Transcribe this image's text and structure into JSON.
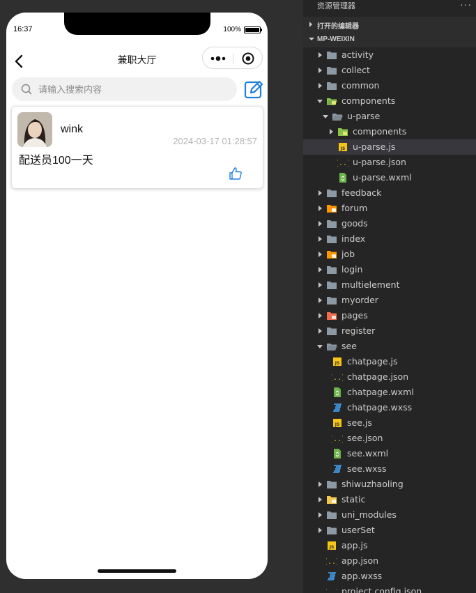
{
  "phone": {
    "status_time": "16:37",
    "battery_text": "100%",
    "nav_title": "兼职大厅",
    "search_placeholder": "请输入搜索内容",
    "post": {
      "author": "wink",
      "timestamp": "2024-03-17 01:28:57",
      "content": "配送员100一天"
    },
    "colors": {
      "accent": "#1e7fe0",
      "text": "#111111",
      "muted": "#b3b3b3"
    }
  },
  "explorer": {
    "title": "资源管理器",
    "more": "···",
    "sections": {
      "open_editors": "打开的编辑器",
      "project": "MP-WEIXIN"
    },
    "items": [
      {
        "label": "activity",
        "kind": "folder",
        "depth": 1,
        "expanded": false
      },
      {
        "label": "collect",
        "kind": "folder",
        "depth": 1,
        "expanded": false
      },
      {
        "label": "common",
        "kind": "folder",
        "depth": 1,
        "expanded": false
      },
      {
        "label": "components",
        "kind": "folder-green",
        "depth": 1,
        "expanded": true
      },
      {
        "label": "u-parse",
        "kind": "folder",
        "depth": 2,
        "expanded": true
      },
      {
        "label": "components",
        "kind": "folder-green",
        "depth": 3,
        "expanded": false
      },
      {
        "label": "u-parse.js",
        "kind": "js",
        "depth": 3,
        "selected": true
      },
      {
        "label": "u-parse.json",
        "kind": "json",
        "depth": 3
      },
      {
        "label": "u-parse.wxml",
        "kind": "wxml",
        "depth": 3
      },
      {
        "label": "feedback",
        "kind": "folder",
        "depth": 1,
        "expanded": false
      },
      {
        "label": "forum",
        "kind": "folder-orange",
        "depth": 1,
        "expanded": false
      },
      {
        "label": "goods",
        "kind": "folder",
        "depth": 1,
        "expanded": false
      },
      {
        "label": "index",
        "kind": "folder",
        "depth": 1,
        "expanded": false
      },
      {
        "label": "job",
        "kind": "folder-orange",
        "depth": 1,
        "expanded": false
      },
      {
        "label": "login",
        "kind": "folder",
        "depth": 1,
        "expanded": false
      },
      {
        "label": "multielement",
        "kind": "folder",
        "depth": 1,
        "expanded": false
      },
      {
        "label": "myorder",
        "kind": "folder",
        "depth": 1,
        "expanded": false
      },
      {
        "label": "pages",
        "kind": "folder-red",
        "depth": 1,
        "expanded": false
      },
      {
        "label": "register",
        "kind": "folder",
        "depth": 1,
        "expanded": false
      },
      {
        "label": "see",
        "kind": "folder",
        "depth": 1,
        "expanded": true
      },
      {
        "label": "chatpage.js",
        "kind": "js",
        "depth": 2
      },
      {
        "label": "chatpage.json",
        "kind": "json",
        "depth": 2
      },
      {
        "label": "chatpage.wxml",
        "kind": "wxml",
        "depth": 2
      },
      {
        "label": "chatpage.wxss",
        "kind": "wxss",
        "depth": 2
      },
      {
        "label": "see.js",
        "kind": "js",
        "depth": 2
      },
      {
        "label": "see.json",
        "kind": "json",
        "depth": 2
      },
      {
        "label": "see.wxml",
        "kind": "wxml",
        "depth": 2
      },
      {
        "label": "see.wxss",
        "kind": "wxss",
        "depth": 2
      },
      {
        "label": "shiwuzhaoling",
        "kind": "folder",
        "depth": 1,
        "expanded": false
      },
      {
        "label": "static",
        "kind": "folder-yellow",
        "depth": 1,
        "expanded": false
      },
      {
        "label": "uni_modules",
        "kind": "folder",
        "depth": 1,
        "expanded": false
      },
      {
        "label": "userSet",
        "kind": "folder",
        "depth": 1,
        "expanded": false
      },
      {
        "label": "app.js",
        "kind": "js",
        "depth": 1
      },
      {
        "label": "app.json",
        "kind": "json",
        "depth": 1
      },
      {
        "label": "app.wxss",
        "kind": "wxss",
        "depth": 1
      },
      {
        "label": "project.config.json",
        "kind": "json",
        "depth": 1
      }
    ]
  }
}
